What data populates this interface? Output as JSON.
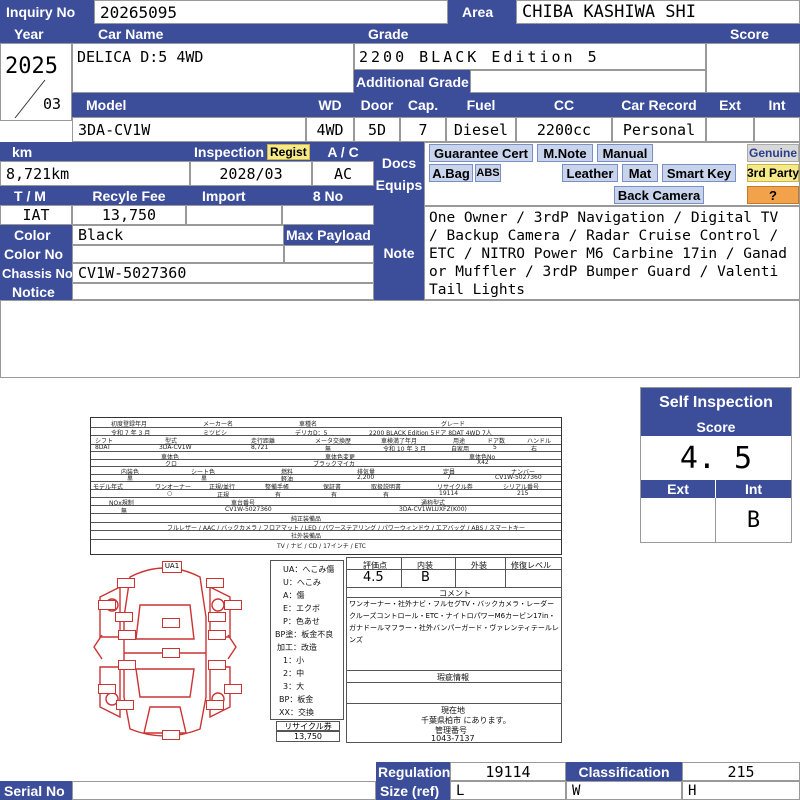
{
  "header": {
    "inquiry_label": "Inquiry No",
    "inquiry_no": "20265095",
    "area_label": "Area",
    "area": "CHIBA KASHIWA SHI"
  },
  "row_labels": {
    "year": "Year",
    "car_name": "Car Name",
    "grade": "Grade",
    "score": "Score",
    "additional_grade": "Additional Grade",
    "model": "Model",
    "wd": "WD",
    "door": "Door",
    "cap": "Cap.",
    "fuel": "Fuel",
    "cc": "CC",
    "car_record": "Car Record",
    "ext": "Ext",
    "int": "Int",
    "km": "km",
    "inspection": "Inspection",
    "regist": "Regist",
    "ac": "A / C",
    "docs_equips": "Docs Equips",
    "tm": "T / M",
    "recycle_fee": "Recyle Fee",
    "import": "Import",
    "eight_no": "8 No",
    "color": "Color",
    "max_payload": "Max Payload",
    "color_no": "Color No",
    "note": "Note",
    "chassis_no": "Chassis No",
    "notice": "Notice",
    "regulation": "Regulation",
    "classification": "Classification",
    "size_ref": "Size (ref)",
    "serial_no": "Serial No"
  },
  "vehicle": {
    "year": "2025",
    "month": "03",
    "car_name": "DELICA D:5 4WD",
    "grade": "2200 BLACK Edition 5",
    "model": "3DA-CV1W",
    "wd": "4WD",
    "door": "5D",
    "cap": "7",
    "fuel": "Diesel",
    "cc": "2200cc",
    "car_record": "Personal",
    "km": "8,721km",
    "inspection": "2028/03",
    "ac": "AC",
    "tm": "IAT",
    "recycle_fee": "13,750",
    "color": "Black",
    "chassis_no": "CV1W-5027360",
    "note": "One Owner / 3rdP Navigation / Digital TV / Backup Camera / Radar Cruise Control / ETC / NITRO Power M6 Carbine 17in / Ganador Muffler / 3rdP Bumper Guard / Valenti Tail Lights",
    "regulation": "19114",
    "classification": "215",
    "size_l": "L",
    "size_w": "W",
    "size_h": "H"
  },
  "equips": {
    "guarantee_cert": "Guarantee Cert",
    "m_note": "M.Note",
    "manual": "Manual",
    "genuine": "Genuine",
    "a_bag": "A.Bag",
    "abs": "ABS",
    "leather": "Leather",
    "mat": "Mat",
    "smart_key": "Smart Key",
    "third_party": "3rd Party",
    "back_camera": "Back Camera",
    "question": "?"
  },
  "self_inspection": {
    "title": "Self Inspection",
    "score_label": "Score",
    "score": "4. 5",
    "ext_label": "Ext",
    "int_label": "Int",
    "ext": "",
    "int": "B"
  },
  "sheet": {
    "row1_labels": [
      "初度登録年月",
      "メーカー名",
      "車種名",
      "グレード"
    ],
    "row1_values": [
      "令和 7 年 3 月",
      "ミツビシ",
      "デリカD：5",
      "2200 BLACK Edition 5ドア 8DAT 4WD 7人"
    ],
    "row2_labels": [
      "シフト",
      "型式",
      "走行距離",
      "メータ交換歴",
      "車検満了年月",
      "用途",
      "ドア数",
      "ハンドル"
    ],
    "row2_values": [
      "8DAT",
      "3DA-CV1W",
      "8,721",
      "無",
      "令和 10 年 3 月",
      "自家用",
      "5",
      "右"
    ],
    "row3_labels": [
      "車体色",
      "車体色変更",
      "車体色No"
    ],
    "row3_values": [
      "クロ",
      "ブラックマイカ",
      "X42"
    ],
    "row4_labels": [
      "内装色",
      "シート色",
      "燃料",
      "排気量",
      "定員",
      "ナンバー"
    ],
    "row4_values": [
      "黒",
      "黒",
      "軽油",
      "2,200",
      "7",
      "CV1W-5027360"
    ],
    "row5_labels": [
      "モデル年式",
      "ワンオーナー",
      "正規/並行",
      "整備手帳",
      "保証書",
      "取扱説明書",
      "リサイクル券",
      "シリアル番号"
    ],
    "row5_values": [
      "",
      "○",
      "正規",
      "有",
      "有",
      "有",
      "19114",
      "215"
    ],
    "row6_labels": [
      "NOx規制",
      "車台番号",
      "通称型式"
    ],
    "row6_values": [
      "無",
      "CV1W-5027360",
      "3DA-CV1WLUXFZ(K00)"
    ],
    "std_equip_label": "純正装備品",
    "std_equip": "フルレザー / AAC / バックカメラ / フロアマット / LED / パワーステアリング / パワーウィンドウ / エアバッグ / ABS / スマートキー",
    "ext_equip_label": "社外装備品",
    "ext_equip": "TV / ナビ / CD / 17インチ / ETC",
    "legend": [
      "UA：へこみ傷",
      "U：へこみ",
      "A：傷",
      "E：エクボ",
      "P：色あせ",
      "BP塗：板金不良",
      "加工：改造",
      "1：小",
      "2：中",
      "3：大",
      "BP：板金",
      "XX：交換"
    ],
    "eval_labels": [
      "評価点",
      "内装",
      "外装",
      "修復レベル"
    ],
    "eval_values": [
      "4.5",
      "B",
      "",
      ""
    ],
    "comment_label": "コメント",
    "comment": "ワンオーナー・社外ナビ・フルセグTV・バックカメラ・レーダークルーズコントロール・ETC・ナイトロパワーM6カービン17in・ガナドールマフラー・社外バンパーガード・ヴァレンティテールレンズ",
    "defect_label": "瑕疵情報",
    "location_label": "現在地",
    "location": "千葉県柏市 にあります。",
    "manage_label": "管理番号",
    "manage_no": "1043-7137",
    "recycle_label": "リサイクル券",
    "recycle_value": "13,750",
    "ua_mark": "UA1"
  },
  "colors": {
    "header_blue": "#3c4d9a",
    "tag_blue": "#c8d4ec",
    "tag_yellow": "#f6e98a",
    "tag_orange": "#f3a24c",
    "damage_red": "#cc3333"
  }
}
